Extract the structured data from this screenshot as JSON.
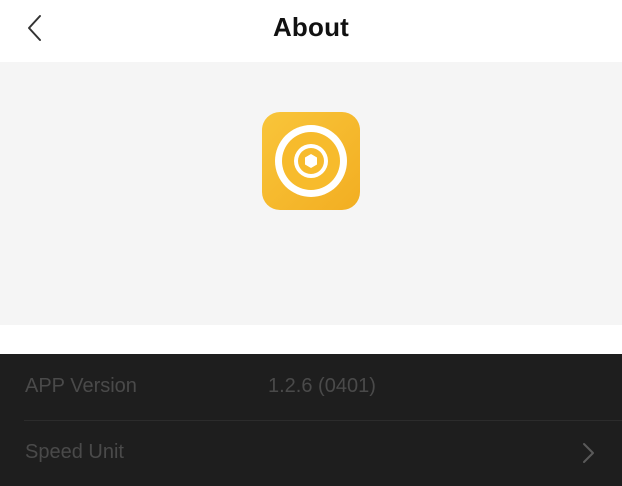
{
  "header": {
    "title": "About",
    "back_icon": "chevron-left-icon"
  },
  "hero": {
    "app_icon": "camera-aperture-app-icon",
    "colors": {
      "background": "#f5f5f5",
      "icon_yellow": "#f7bd2f",
      "icon_ring": "#ffffff"
    }
  },
  "settings": {
    "rows": [
      {
        "label": "APP Version",
        "value": "1.2.6 (0401)"
      },
      {
        "label": "Speed Unit",
        "value": "",
        "trailing_icon": "chevron-right-icon"
      }
    ],
    "colors": {
      "background": "#1e1e1e",
      "text": "#4a4a4a"
    }
  }
}
